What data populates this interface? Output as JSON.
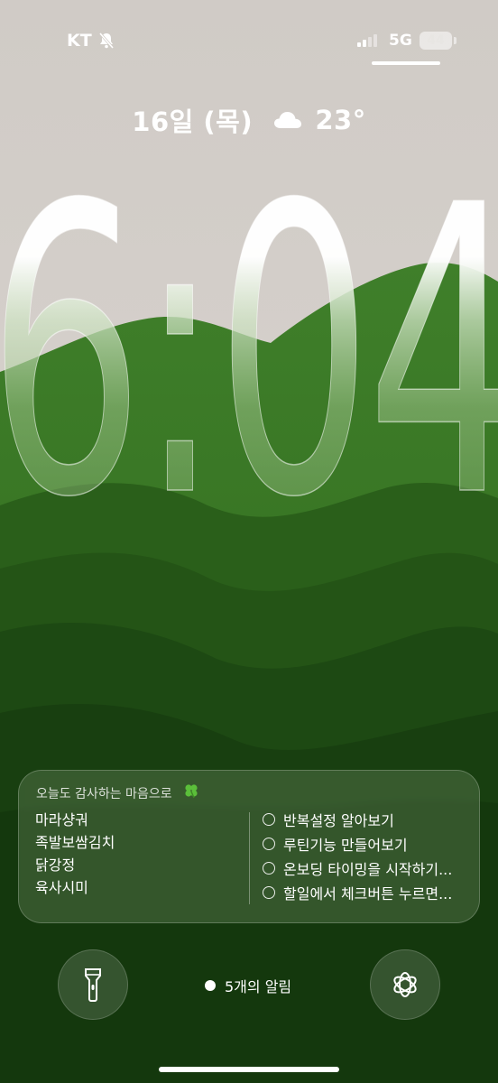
{
  "status_bar": {
    "carrier": "KT",
    "network": "5G",
    "battery": "44",
    "icons": [
      "bell-slash-icon",
      "signal-bars-icon",
      "battery-icon"
    ]
  },
  "lock_screen": {
    "date": "16일 (목)",
    "weather_icon": "cloud-icon",
    "temperature": "23°",
    "time": "6:04"
  },
  "widget": {
    "title": "오늘도 감사하는 마음으로",
    "title_icon": "four-leaf-clover-icon",
    "gratitude_items": [
      "마라샹궈",
      "족발보쌈김치",
      "닭강정",
      "육사시미"
    ],
    "todos": [
      {
        "label": "반복설정 알아보기"
      },
      {
        "label": "루틴기능 만들어보기"
      },
      {
        "label": "온보딩 타이밍을 시작하기..."
      },
      {
        "label": "할일에서 체크버튼 누르면..."
      }
    ]
  },
  "bottom": {
    "left_button_icon": "flashlight-icon",
    "right_button_icon": "chatgpt-logo-icon",
    "notifications": "5개의 알림"
  },
  "colors": {
    "sky": "#d7d2cd",
    "hill_front": "#2f6a1c",
    "hill_dark": "#163a10",
    "text": "#ffffff"
  }
}
